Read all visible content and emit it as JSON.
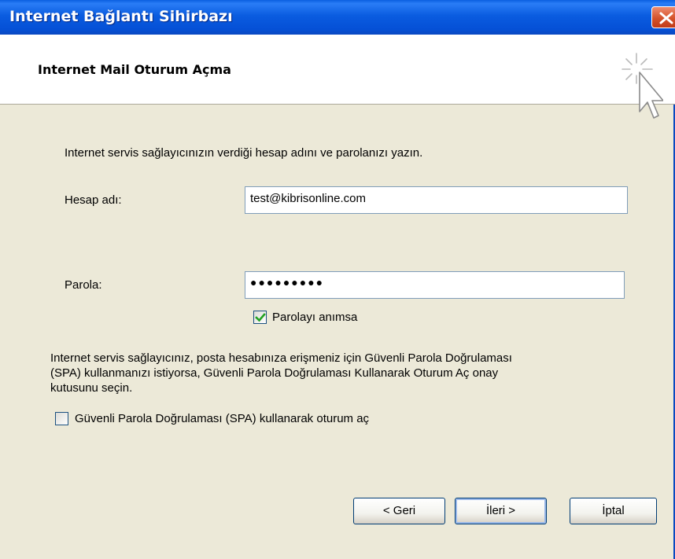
{
  "window": {
    "title": "Internet Bağlantı Sihirbazı",
    "close_icon": "close-icon"
  },
  "header": {
    "title": "Internet Mail Oturum Açma",
    "icon": "wizard-pointer-icon"
  },
  "form": {
    "intro": "Internet servis sağlayıcınızın verdiği hesap adını ve parolanızı yazın.",
    "account_label": "Hesap adı:",
    "account_value": "test@kibrisonline.com",
    "password_label": "Parola:",
    "password_value": "●●●●●●●●●",
    "remember_label": "Parolayı anımsa",
    "remember_checked": true,
    "spa_paragraph_line1": "Internet servis sağlayıcınız, posta hesabınıza erişmeniz için Güvenli Parola Doğrulaması",
    "spa_paragraph_line2": "(SPA) kullanmanızı istiyorsa, Güvenli Parola Doğrulaması Kullanarak Oturum Aç onay",
    "spa_paragraph_line3": "kutusunu seçin.",
    "spa_label": "Güvenli Parola Doğrulaması (SPA) kullanarak oturum aç",
    "spa_checked": false
  },
  "buttons": {
    "back": "< Geri",
    "next": "İleri >",
    "cancel": "İptal"
  },
  "colors": {
    "titlebar": "#0a5ce0",
    "dialog_bg": "#ece9d8",
    "check_green": "#21a121"
  }
}
